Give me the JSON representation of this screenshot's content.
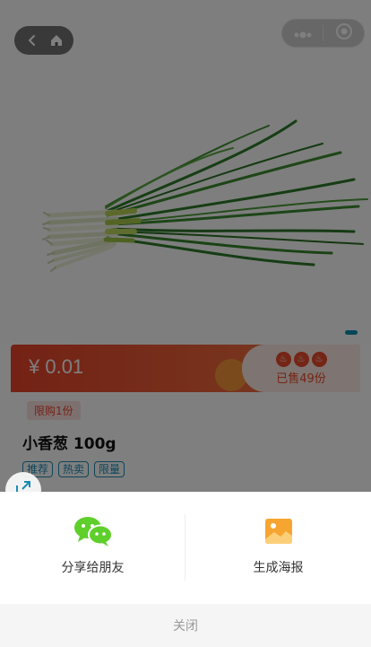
{
  "product": {
    "price": "¥ 0.01",
    "sold": "已售49份",
    "limit": "限购1份",
    "title": "小香葱 100g",
    "tags": [
      "推荐",
      "热卖",
      "限量"
    ]
  },
  "share_sheet": {
    "options": [
      {
        "label": "分享给朋友",
        "icon": "wechat-icon"
      },
      {
        "label": "生成海报",
        "icon": "poster-image-icon"
      }
    ],
    "close_label": "关闭"
  },
  "colors": {
    "accent_red": "#e8442a",
    "tag_blue": "#1a8bb3",
    "wechat_green": "#5fcf2c",
    "poster_orange": "#f7a531"
  }
}
